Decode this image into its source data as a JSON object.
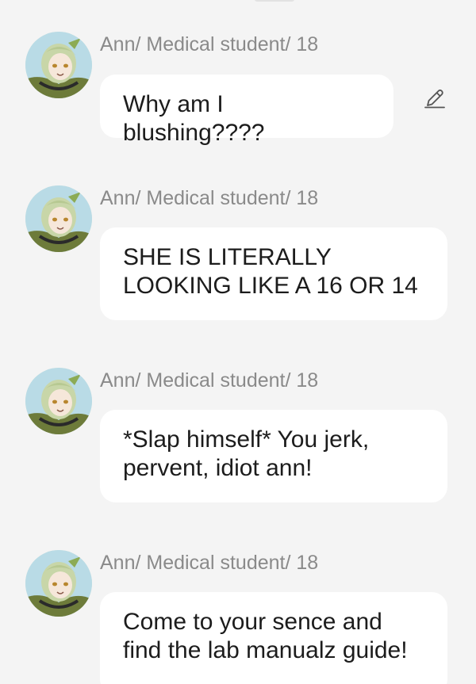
{
  "messages": [
    {
      "sender": "Ann/ Medical student/ 18",
      "text": "Why am I blushing????"
    },
    {
      "sender": "Ann/ Medical student/ 18",
      "text": "SHE IS LITERALLY\nLOOKING LIKE A 16 OR 14"
    },
    {
      "sender": "Ann/ Medical student/ 18",
      "text": "*Slap himself* You jerk,\npervent, idiot ann!"
    },
    {
      "sender": "Ann/ Medical student/ 18",
      "text": "Come to your sence and\nfind the lab manualz guide!"
    }
  ],
  "icons": {
    "edit": "pencil-icon",
    "avatar": "avatar"
  }
}
